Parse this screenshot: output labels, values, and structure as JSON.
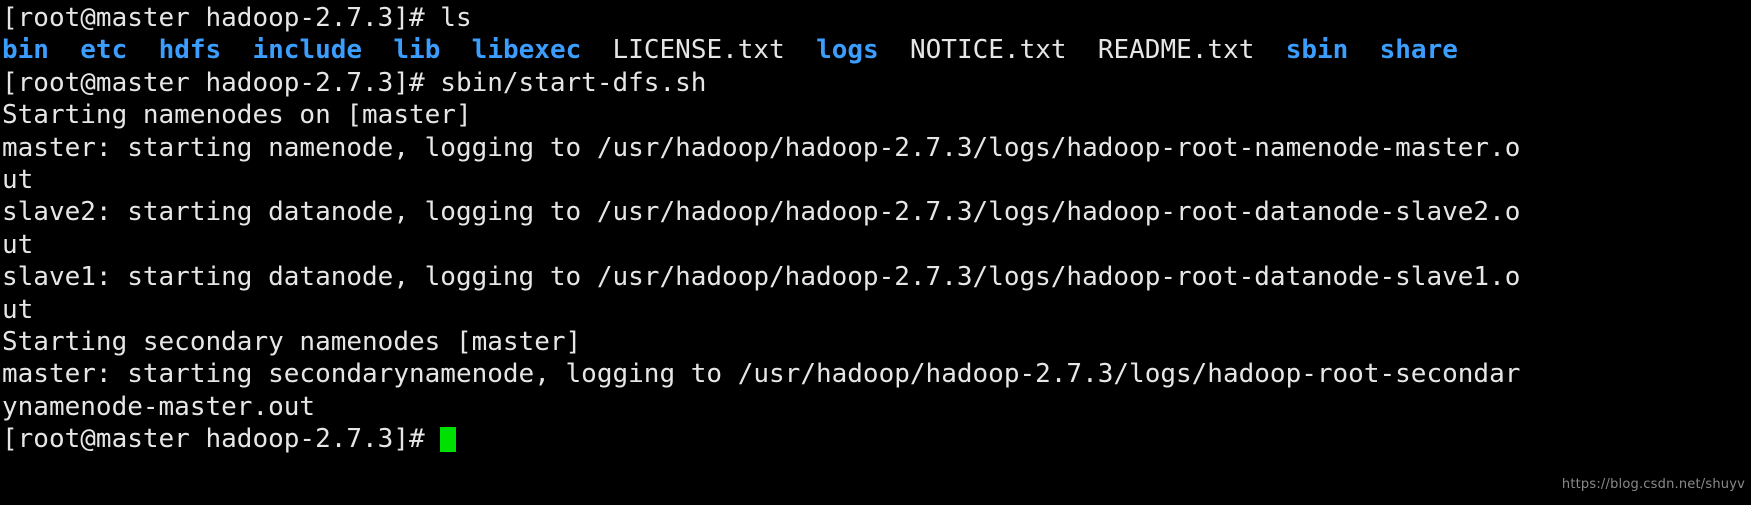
{
  "terminal": {
    "background_color": "#000000",
    "foreground_color": "#e6e6e6",
    "directory_color": "#3b9eff",
    "cursor_color": "#00e000",
    "prompt": "[root@master hadoop-2.7.3]# ",
    "lines": [
      {
        "id": "line-1-prompt-ls",
        "segments": [
          {
            "text": "[root@master hadoop-2.7.3]# ls",
            "style": "default"
          }
        ]
      },
      {
        "id": "line-2-ls-output",
        "segments": [
          {
            "text": "bin",
            "style": "dir"
          },
          {
            "text": "  ",
            "style": "default"
          },
          {
            "text": "etc",
            "style": "dir"
          },
          {
            "text": "  ",
            "style": "default"
          },
          {
            "text": "hdfs",
            "style": "dir"
          },
          {
            "text": "  ",
            "style": "default"
          },
          {
            "text": "include",
            "style": "dir"
          },
          {
            "text": "  ",
            "style": "default"
          },
          {
            "text": "lib",
            "style": "dir"
          },
          {
            "text": "  ",
            "style": "default"
          },
          {
            "text": "libexec",
            "style": "dir"
          },
          {
            "text": "  LICENSE.txt  ",
            "style": "default"
          },
          {
            "text": "logs",
            "style": "dir"
          },
          {
            "text": "  NOTICE.txt  README.txt  ",
            "style": "default"
          },
          {
            "text": "sbin",
            "style": "dir"
          },
          {
            "text": "  ",
            "style": "default"
          },
          {
            "text": "share",
            "style": "dir"
          }
        ]
      },
      {
        "id": "line-3-prompt-startdfs",
        "segments": [
          {
            "text": "[root@master hadoop-2.7.3]# sbin/start-dfs.sh",
            "style": "default"
          }
        ]
      },
      {
        "id": "line-4-starting-namenodes",
        "segments": [
          {
            "text": "Starting namenodes on [master]",
            "style": "default"
          }
        ]
      },
      {
        "id": "line-5-master-namenode",
        "segments": [
          {
            "text": "master: starting namenode, logging to /usr/hadoop/hadoop-2.7.3/logs/hadoop-root-namenode-master.o",
            "style": "default"
          }
        ]
      },
      {
        "id": "line-6-wrap-ut-a",
        "segments": [
          {
            "text": "ut",
            "style": "default"
          }
        ]
      },
      {
        "id": "line-7-slave2-datanode",
        "segments": [
          {
            "text": "slave2: starting datanode, logging to /usr/hadoop/hadoop-2.7.3/logs/hadoop-root-datanode-slave2.o",
            "style": "default"
          }
        ]
      },
      {
        "id": "line-8-wrap-ut-b",
        "segments": [
          {
            "text": "ut",
            "style": "default"
          }
        ]
      },
      {
        "id": "line-9-slave1-datanode",
        "segments": [
          {
            "text": "slave1: starting datanode, logging to /usr/hadoop/hadoop-2.7.3/logs/hadoop-root-datanode-slave1.o",
            "style": "default"
          }
        ]
      },
      {
        "id": "line-10-wrap-ut-c",
        "segments": [
          {
            "text": "ut",
            "style": "default"
          }
        ]
      },
      {
        "id": "line-11-starting-secondary",
        "segments": [
          {
            "text": "Starting secondary namenodes [master]",
            "style": "default"
          }
        ]
      },
      {
        "id": "line-12-master-secondarynamenode",
        "segments": [
          {
            "text": "master: starting secondarynamenode, logging to /usr/hadoop/hadoop-2.7.3/logs/hadoop-root-secondar",
            "style": "default"
          }
        ]
      },
      {
        "id": "line-13-wrap-ynamenode",
        "segments": [
          {
            "text": "ynamenode-master.out",
            "style": "default"
          }
        ]
      },
      {
        "id": "line-14-final-prompt",
        "segments": [
          {
            "text": "[root@master hadoop-2.7.3]# ",
            "style": "default"
          }
        ],
        "cursor": true
      }
    ]
  },
  "watermark": {
    "text": "https://blog.csdn.net/shuyv"
  }
}
